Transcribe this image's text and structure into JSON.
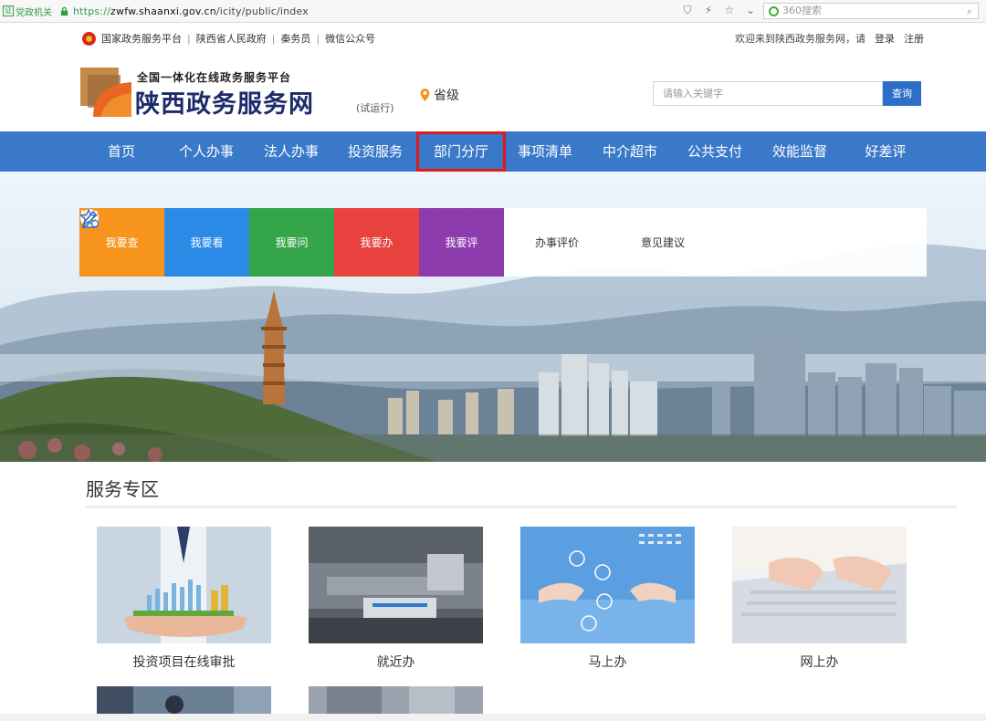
{
  "browser": {
    "gov_badge": "党政机关",
    "url_proto": "https://",
    "url_host": "zwfw.shaanxi.gov.cn",
    "url_path": "/icity/public/index",
    "search_placeholder": "360搜索"
  },
  "topbar": {
    "links": [
      "国家政务服务平台",
      "陕西省人民政府",
      "秦务员",
      "微信公众号"
    ],
    "welcome": "欢迎来到陕西政务服务网，请",
    "login": "登录",
    "register": "注册"
  },
  "header": {
    "subtitle": "全国一体化在线政务服务平台",
    "title": "陕西政务服务网",
    "trial": "(试运行)",
    "province": "省级",
    "search_placeholder": "请输入关键字",
    "search_button": "查询"
  },
  "nav": {
    "items": [
      "首页",
      "个人办事",
      "法人办事",
      "投资服务",
      "部门分厅",
      "事项清单",
      "中介超市",
      "公共支付",
      "效能监督",
      "好差评"
    ],
    "highlighted": "部门分厅"
  },
  "banner": {
    "tiles": [
      "我要查",
      "我要看",
      "我要问",
      "我要办",
      "我要评"
    ],
    "white_tiles": [
      "办事评价",
      "意见建议"
    ]
  },
  "services": {
    "title": "服务专区",
    "cards": [
      "投资项目在线审批",
      "就近办",
      "马上办",
      "网上办"
    ]
  },
  "colors": {
    "nav_bg": "#3a79c9",
    "highlight": "#e01a1a",
    "tile_orange": "#f7941d",
    "tile_blue": "#2a8ae6",
    "tile_green": "#35a54a",
    "tile_red": "#e8423f",
    "tile_purple": "#8d3cad"
  }
}
